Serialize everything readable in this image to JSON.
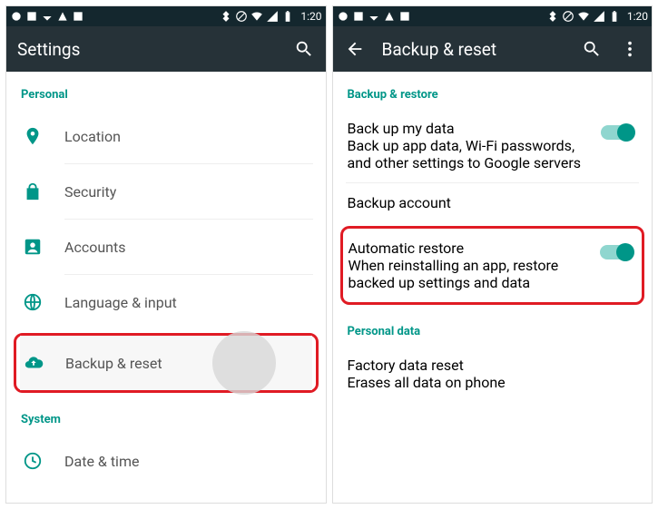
{
  "status": {
    "time": "1:20"
  },
  "left": {
    "title": "Settings",
    "section_personal": "Personal",
    "items": {
      "location": "Location",
      "security": "Security",
      "accounts": "Accounts",
      "language": "Language & input",
      "backup": "Backup & reset"
    },
    "section_system": "System",
    "items_system": {
      "datetime": "Date & time"
    }
  },
  "right": {
    "title": "Backup & reset",
    "section_backup": "Backup & restore",
    "backup_data": {
      "title": "Back up my data",
      "sub": "Back up app data, Wi-Fi passwords, and other settings to Google servers"
    },
    "backup_account": "Backup account",
    "auto_restore": {
      "title": "Automatic restore",
      "sub": "When reinstalling an app, restore backed up settings and data"
    },
    "section_personal": "Personal data",
    "factory": {
      "title": "Factory data reset",
      "sub": "Erases all data on phone"
    }
  }
}
